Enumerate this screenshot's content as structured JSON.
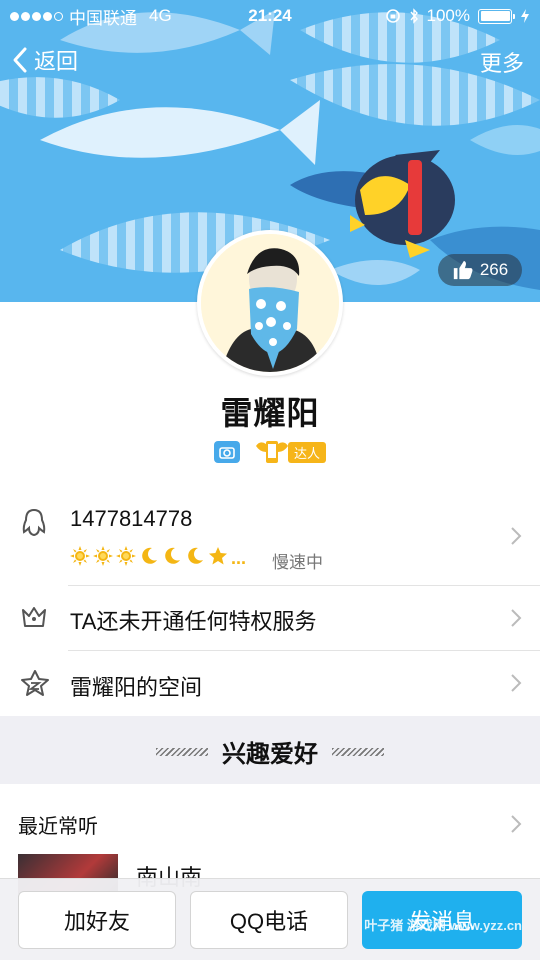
{
  "status_bar": {
    "carrier": "中国联通",
    "network": "4G",
    "time": "21:24",
    "battery": "100%",
    "battery_level": 1.0
  },
  "navbar": {
    "back_label": "返回",
    "more_label": "更多"
  },
  "banner": {
    "like_count": "266",
    "accent_color": "#58b6ee"
  },
  "profile": {
    "name": "雷耀阳",
    "badge_label": "达人"
  },
  "qq_row": {
    "number": "1477814778",
    "level_icons": [
      "sun-icon",
      "sun-icon",
      "sun-icon",
      "moon-icon",
      "moon-icon",
      "moon-icon",
      "star-icon"
    ],
    "level_more": "...",
    "level_status": "慢速中"
  },
  "vip_row": {
    "label": "TA还未开通任何特权服务"
  },
  "space_row": {
    "label": "雷耀阳的空间"
  },
  "hobbies": {
    "section_title": "兴趣爱好",
    "recent_label": "最近常听",
    "song_title": "南山南"
  },
  "bottom_bar": {
    "add_friend": "加好友",
    "qq_call": "QQ电话",
    "send_message": "发消息",
    "accent_color": "#1fb0ee"
  },
  "watermark": "叶子猪 游戏网 www.yzz.cn"
}
